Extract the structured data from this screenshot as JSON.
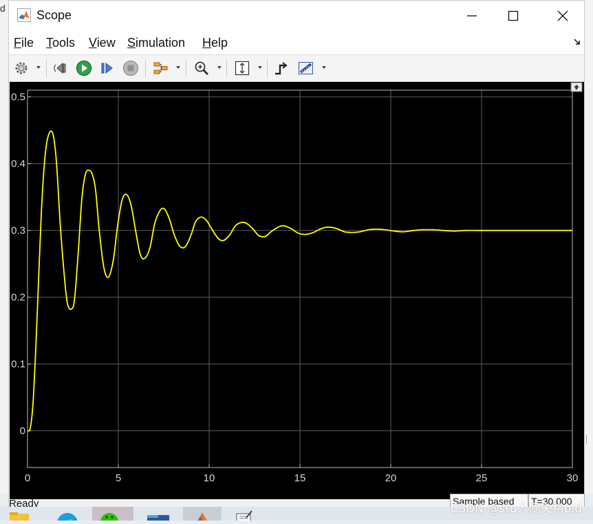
{
  "background": {
    "left_fragment_text": "d"
  },
  "window": {
    "title": "Scope",
    "app_icon": "matlab-logo-icon",
    "controls": [
      "minimize-icon",
      "maximize-icon",
      "close-icon"
    ]
  },
  "menu": {
    "items": [
      {
        "label": "File",
        "mnemonic": "F",
        "rest": "ile"
      },
      {
        "label": "Tools",
        "mnemonic": "T",
        "rest": "ools"
      },
      {
        "label": "View",
        "mnemonic": "V",
        "rest": "iew"
      },
      {
        "label": "Simulation",
        "mnemonic": "S",
        "rest": "imulation"
      },
      {
        "label": "Help",
        "mnemonic": "H",
        "rest": "elp"
      }
    ]
  },
  "toolbar": {
    "buttons": [
      "configuration-properties-icon",
      "step-back-icon",
      "run-icon",
      "step-forward-icon",
      "stop-icon",
      "signal-selection-icon",
      "zoom-in-icon",
      "scale-axes-icon",
      "triggers-icon",
      "cursor-measurements-icon"
    ]
  },
  "chart_data": {
    "type": "line",
    "title": "",
    "xlabel": "",
    "ylabel": "",
    "xlim": [
      0,
      30
    ],
    "ylim": [
      -0.055,
      0.51
    ],
    "xticks": [
      0,
      5,
      10,
      15,
      20,
      25,
      30
    ],
    "xtick_labels": [
      "0",
      "5",
      "10",
      "15",
      "20",
      "25",
      "30"
    ],
    "yticks": [
      0,
      0.1,
      0.2,
      0.3,
      0.4,
      0.5
    ],
    "ytick_labels": [
      "0",
      "0.1",
      "0.2",
      "0.3",
      "0.4",
      "0.5"
    ],
    "grid": true,
    "series": [
      {
        "color": "#ffff00",
        "x": [
          0,
          0.15,
          0.3,
          0.45,
          0.6,
          0.75,
          0.9,
          1.05,
          1.2,
          1.33,
          1.45,
          1.6,
          1.8,
          2.0,
          2.2,
          2.45,
          2.6,
          2.8,
          3.0,
          3.2,
          3.4,
          3.58,
          3.75,
          3.95,
          4.2,
          4.45,
          4.72,
          4.95,
          5.2,
          5.45,
          5.7,
          5.95,
          6.2,
          6.45,
          6.75,
          7.0,
          7.3,
          7.55,
          7.8,
          8.1,
          8.4,
          8.7,
          9.0,
          9.25,
          9.55,
          9.85,
          10.15,
          10.5,
          10.8,
          11.15,
          11.45,
          11.8,
          12.1,
          12.45,
          12.75,
          13.1,
          13.4,
          13.8,
          14.1,
          14.5,
          14.9,
          15.3,
          15.75,
          16.1,
          16.55,
          17.0,
          17.45,
          17.9,
          18.3,
          18.75,
          19.2,
          19.7,
          20.2,
          20.7,
          21.3,
          21.8,
          22.3,
          22.9,
          23.5,
          24.1,
          24.7,
          25.3,
          25.9,
          26.5,
          27.2,
          27.9,
          28.6,
          29.3,
          30.0
        ],
        "y": [
          0.0,
          0.004,
          0.04,
          0.12,
          0.22,
          0.32,
          0.39,
          0.43,
          0.446,
          0.448,
          0.438,
          0.4,
          0.31,
          0.24,
          0.19,
          0.183,
          0.2,
          0.27,
          0.35,
          0.385,
          0.39,
          0.383,
          0.36,
          0.3,
          0.245,
          0.23,
          0.255,
          0.305,
          0.345,
          0.354,
          0.338,
          0.3,
          0.265,
          0.258,
          0.275,
          0.31,
          0.33,
          0.332,
          0.318,
          0.292,
          0.276,
          0.276,
          0.293,
          0.313,
          0.32,
          0.315,
          0.302,
          0.288,
          0.285,
          0.294,
          0.307,
          0.312,
          0.31,
          0.301,
          0.292,
          0.291,
          0.298,
          0.305,
          0.307,
          0.303,
          0.296,
          0.294,
          0.297,
          0.302,
          0.305,
          0.303,
          0.298,
          0.297,
          0.298,
          0.301,
          0.302,
          0.301,
          0.299,
          0.298,
          0.3,
          0.301,
          0.301,
          0.3,
          0.299,
          0.3,
          0.3,
          0.3,
          0.3,
          0.3,
          0.3,
          0.3,
          0.3,
          0.3,
          0.3
        ]
      }
    ]
  },
  "status": {
    "ready": "Ready",
    "sample_based": "Sample based",
    "time": "T=30.000"
  },
  "taskbar": {
    "apps": [
      "file-explorer-icon",
      "edge-browser-icon",
      "wechat-icon",
      "word-icon",
      "matlab-taskbar-icon",
      "notepad-icon"
    ]
  },
  "watermark": "CSDN @stu人间失格pid"
}
